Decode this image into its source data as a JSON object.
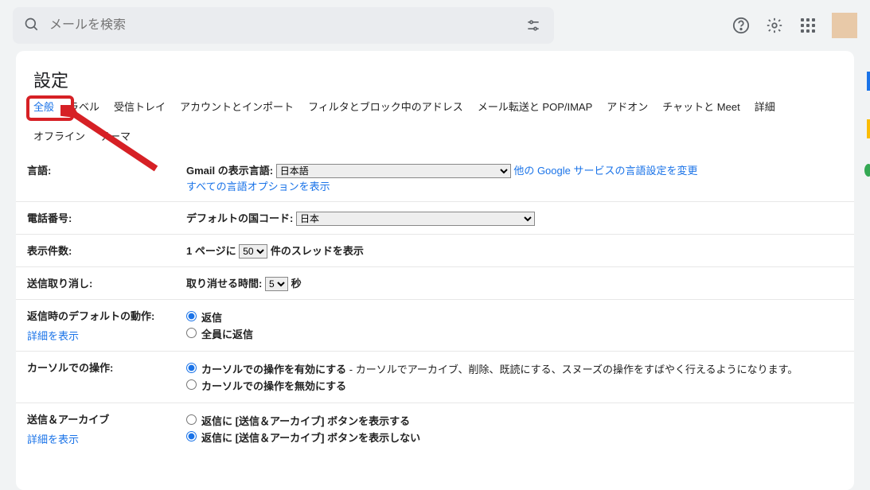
{
  "search": {
    "placeholder": "メールを検索"
  },
  "title": "設定",
  "tabs": {
    "general": "全般",
    "labels": "ラベル",
    "inbox": "受信トレイ",
    "accounts": "アカウントとインポート",
    "filters": "フィルタとブロック中のアドレス",
    "fwd": "メール転送と POP/IMAP",
    "addons": "アドオン",
    "chat": "チャットと Meet",
    "advanced": "詳細",
    "offline": "オフライン",
    "themes": "テーマ"
  },
  "lang": {
    "row_label": "言語:",
    "display_label": "Gmail の表示言語:",
    "select_value": "日本語",
    "other_link": "他の Google サービスの言語設定を変更",
    "show_all_link": "すべての言語オプションを表示"
  },
  "phone": {
    "row_label": "電話番号:",
    "default_label": "デフォルトの国コード:",
    "select_value": "日本"
  },
  "pagesize": {
    "row_label": "表示件数:",
    "before": "1 ページに ",
    "value": "50",
    "after": " 件のスレッドを表示"
  },
  "undo": {
    "row_label": "送信取り消し:",
    "before": "取り消せる時間: ",
    "value": "5",
    "after": " 秒"
  },
  "reply": {
    "row_label": "返信時のデフォルトの動作:",
    "details": "詳細を表示",
    "opt_reply": "返信",
    "opt_reply_all": "全員に返信"
  },
  "hover": {
    "row_label": "カーソルでの操作:",
    "enable_label": "カーソルでの操作を有効にする",
    "enable_desc": " - カーソルでアーカイブ、削除、既読にする、スヌーズの操作をすばやく行えるようになります。",
    "disable_label": "カーソルでの操作を無効にする"
  },
  "send_archive": {
    "row_label": "送信＆アーカイブ",
    "details": "詳細を表示",
    "show": "返信に [送信＆アーカイブ] ボタンを表示する",
    "hide": "返信に [送信＆アーカイブ] ボタンを表示しない"
  }
}
